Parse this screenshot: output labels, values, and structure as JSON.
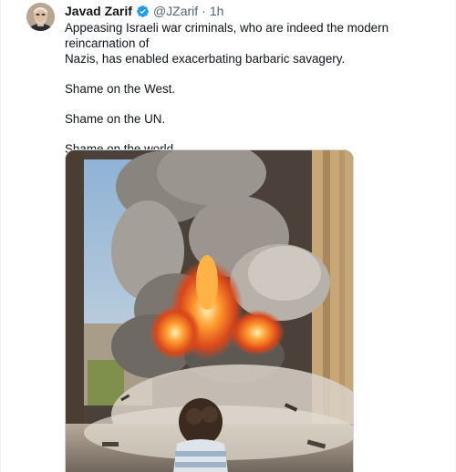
{
  "tweet": {
    "author": {
      "display_name": "Javad Zarif",
      "handle": "@JZarif",
      "verified": true,
      "verified_color": "#1d9bf0"
    },
    "time_separator": "·",
    "timestamp": "1h",
    "text_lines": [
      "Appeasing Israeli war criminals, who are indeed the modern reincarnation of",
      "Nazis, has enabled exacerbating  barbaric savagery."
    ],
    "paragraphs": [
      "Shame on the West.",
      "Shame on the UN.",
      "Shame on the world."
    ],
    "media": {
      "icon": "photo"
    }
  }
}
